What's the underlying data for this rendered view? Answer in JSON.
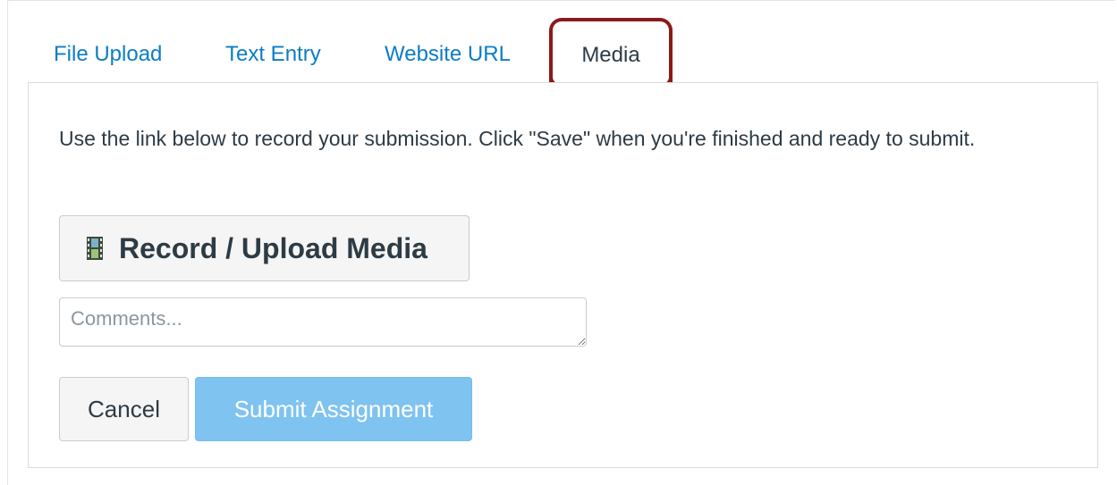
{
  "tabs": {
    "file_upload": "File Upload",
    "text_entry": "Text Entry",
    "website_url": "Website URL",
    "media": "Media",
    "active": "Media"
  },
  "panel": {
    "instructions": "Use the link below to record your submission. Click \"Save\" when you're finished and ready to submit.",
    "record_button_label": "Record / Upload Media",
    "record_button_icon": "film-strip-icon",
    "comments_placeholder": "Comments...",
    "comments_value": "",
    "cancel_label": "Cancel",
    "submit_label": "Submit Assignment"
  },
  "colors": {
    "link_blue": "#0b7dc5",
    "highlight_red": "#8b1a1a",
    "submit_disabled_blue": "#7fc3f0",
    "text_dark": "#2d3b45"
  }
}
